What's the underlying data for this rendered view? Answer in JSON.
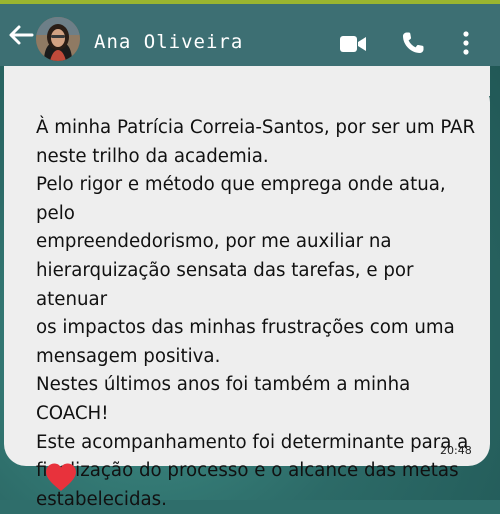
{
  "header": {
    "contact_name": "Ana Oliveira",
    "back_icon": "arrow-left-icon",
    "video_icon": "video-camera-icon",
    "call_icon": "phone-icon",
    "menu_icon": "more-vert-icon"
  },
  "message": {
    "text": "À minha Patrícia Correia-Santos, por ser um PAR\nneste trilho da academia.\nPelo rigor e método que emprega onde atua, pelo\nempreendedorismo, por me auxiliar na\nhierarquização sensata das tarefas, e por atenuar\nos impactos das minhas frustrações com uma\nmensagem positiva.\nNestes últimos anos foi também a minha\nCOACH!\nEste acompanhamento foi determinante para a\nfinalização do processo e o alcance das metas\nestabelecidas.",
    "time": "20:48",
    "reaction": "heart-icon"
  },
  "colors": {
    "header_bg": "#3d6f73",
    "bubble_bg": "#eeeeee",
    "heart": "#e8323c"
  }
}
